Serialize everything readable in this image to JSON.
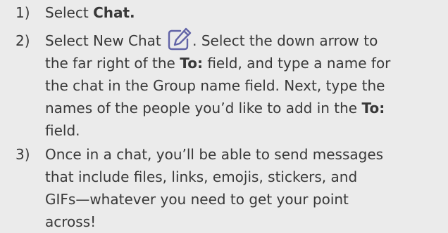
{
  "steps": [
    {
      "number": "1)",
      "lines": [
        {
          "a": "Select ",
          "b": "Chat."
        }
      ]
    },
    {
      "number": "2)",
      "lines": [
        {
          "a": "Select New Chat ",
          "icon": "new-chat-compose-icon",
          "b": ". Select the down arrow to"
        },
        {
          "a": "the far right of the ",
          "b": "To:",
          "c": " field, and type a name for"
        },
        {
          "a": "the chat in the Group name field. Next, type the"
        },
        {
          "a": "names of the people you’d like to add in the ",
          "b": "To:"
        },
        {
          "a": "field."
        }
      ]
    },
    {
      "number": "3)",
      "lines": [
        {
          "a": "Once in a chat, you’ll be able to send messages"
        },
        {
          "a": "that include files, links, emojis, stickers, and"
        },
        {
          "a": "GIFs—whatever you need to get your point"
        },
        {
          "a": "across!"
        }
      ]
    }
  ],
  "colors": {
    "background": "#ebebeb",
    "text": "#383838",
    "icon": "#6264a7"
  }
}
